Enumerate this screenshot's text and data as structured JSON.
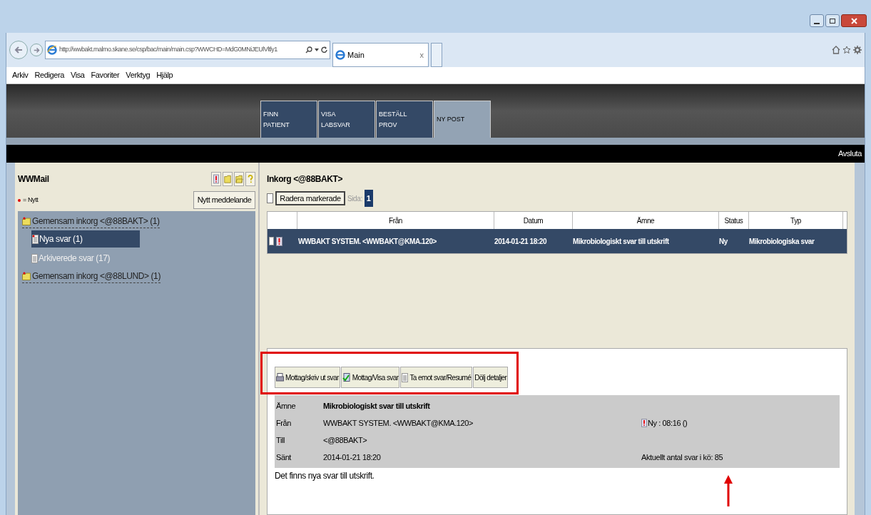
{
  "browser": {
    "address": "http://wwbakt.malmo.skane.se/csp/bac/main/main.csp?WWCHD=MdG0MNiJEUlVltly1",
    "tab": {
      "title": "Main",
      "close": "x"
    },
    "menu": [
      "Arkiv",
      "Redigera",
      "Visa",
      "Favoriter",
      "Verktyg",
      "Hjälp"
    ]
  },
  "app_tabs": [
    {
      "line1": "FINN",
      "line2": "PATIENT",
      "selected": false
    },
    {
      "line1": "VISA",
      "line2": "LABSVAR",
      "selected": false
    },
    {
      "line1": "BESTÄLL",
      "line2": "PROV",
      "selected": false
    },
    {
      "line1": "NY POST",
      "selected": true
    }
  ],
  "logout": "Avsluta",
  "sidebar": {
    "title": "WWMail",
    "legend": "= Nytt",
    "new_message": "Nytt meddelande",
    "tree": [
      {
        "label": "Gemensam inkorg <@88BAKT> (1)",
        "new": true,
        "selected": false,
        "children": [
          {
            "label": "Nya svar (1)",
            "new": true,
            "selected": true
          },
          {
            "label": "Arkiverede svar (17)",
            "new": false,
            "selected": false
          }
        ]
      },
      {
        "label": "Gemensam inkorg <@88LUND> (1)",
        "new": true,
        "selected": false
      }
    ]
  },
  "inbox": {
    "title": "Inkorg <@88BAKT>",
    "delete_button": "Radera markerade",
    "page_label": "Sida:",
    "page": "1",
    "select_all": false,
    "columns": [
      "Från",
      "Datum",
      "Ämne",
      "Status",
      "Typ"
    ],
    "rows": [
      {
        "from": "WWBAKT SYSTEM. <WWBAKT@KMA.120>",
        "date": "2014-01-21 18:20",
        "subject": "Mikrobiologiskt svar till utskrift",
        "status": "Ny",
        "type": "Mikrobiologiska svar",
        "checked": false,
        "selected": true
      }
    ]
  },
  "detail": {
    "actions": [
      "Mottag/skriv ut svar",
      "Mottag/Visa svar",
      "Ta emot svar/Resumé",
      "Dölj detaljer"
    ],
    "fields": [
      {
        "label": "Ämne",
        "value": "Mikrobiologiskt svar till utskrift"
      },
      {
        "label": "Från",
        "value": "WWBAKT SYSTEM. <WWBAKT@KMA.120>"
      },
      {
        "label": "Till",
        "value": "<@88BAKT>"
      },
      {
        "label": "Sänt",
        "value": "2014-01-21 18:20"
      }
    ],
    "status": "Ny : 08:16 ()",
    "queue": "Aktuellt antal svar i kö: 85",
    "body": "Det finns nya svar till utskrift."
  }
}
